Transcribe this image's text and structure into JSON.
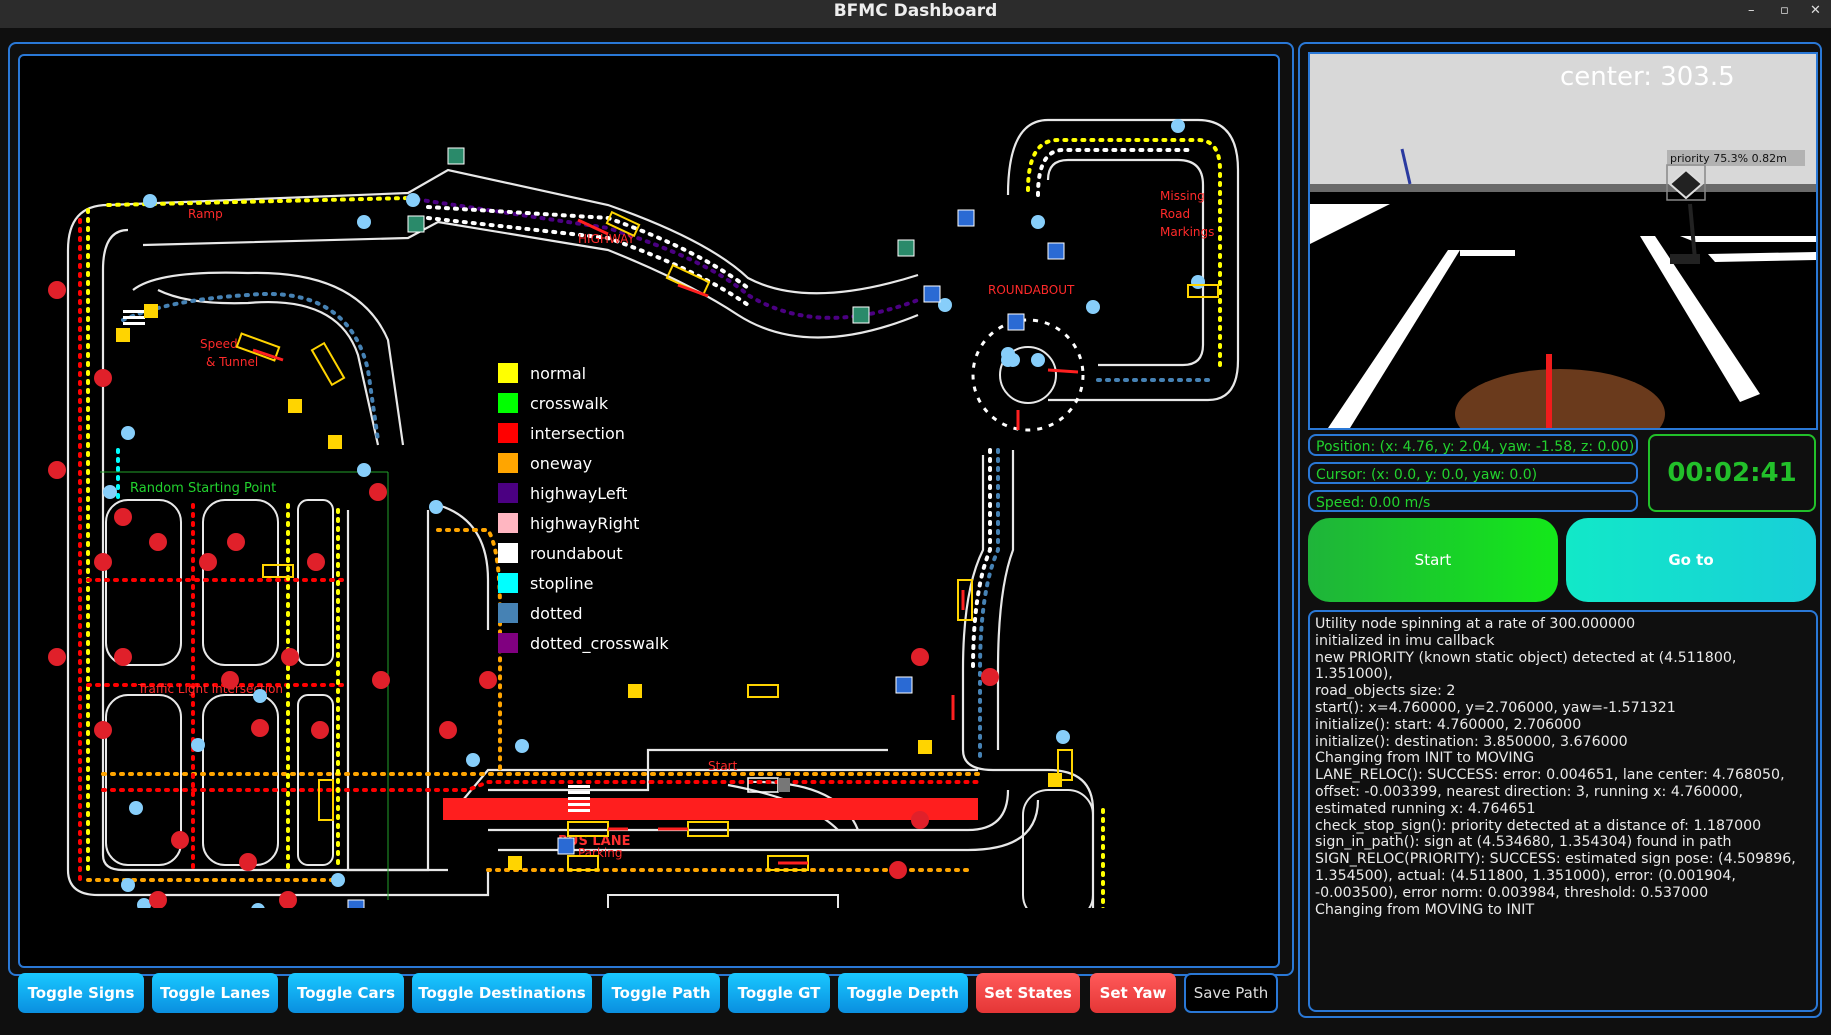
{
  "window": {
    "title": "BFMC Dashboard",
    "minimize": "–",
    "maximize": "▫",
    "close": "✕"
  },
  "camera": {
    "center_label": "center:",
    "center_value": "303.5",
    "detection_label": "priority  75.3%  0.82m"
  },
  "status": {
    "position": "Position: (x: 4.76, y: 2.04, yaw: -1.58, z: 0.00)",
    "cursor": "Cursor: (x: 0.0, y: 0.0, yaw: 0.0)",
    "speed": "Speed: 0.00 m/s",
    "timer": "00:02:41"
  },
  "actions": {
    "start": "Start",
    "goto": "Go to"
  },
  "log": [
    "Utility node spinning at a rate of 300.000000",
    "initialized in imu callback",
    "new PRIORITY (known static object) detected at (4.511800, 1.351000),",
    "road_objects size: 2",
    "start(): x=4.760000, y=2.706000, yaw=-1.571321",
    "initialize(): start: 4.760000, 2.706000",
    "initialize(): destination: 3.850000, 3.676000",
    "Changing from INIT to MOVING",
    "LANE_RELOC(): SUCCESS: error: 0.004651, lane center: 4.768050, offset: -0.003399, nearest direction: 3, running x: 4.760000, estimated running x: 4.764651",
    "check_stop_sign(): priority detected at a distance of: 1.187000",
    "sign_in_path(): sign at (4.534680, 1.354304) found in path",
    "SIGN_RELOC(PRIORITY): SUCCESS: estimated sign pose: (4.509896, 1.354500), actual: (4.511800, 1.351000), error: (0.001904, -0.003500), error norm: 0.003984, threshold: 0.537000",
    "Changing from MOVING to INIT"
  ],
  "toolbar": {
    "toggle_signs": "Toggle Signs",
    "toggle_lanes": "Toggle Lanes",
    "toggle_cars": "Toggle Cars",
    "toggle_destinations": "Toggle Destinations",
    "toggle_path": "Toggle Path",
    "toggle_gt": "Toggle GT",
    "toggle_depth": "Toggle Depth",
    "set_states": "Set States",
    "set_yaw": "Set Yaw",
    "save_path": "Save Path"
  },
  "map": {
    "labels": {
      "ramp": "Ramp",
      "highway": "HIGHWAY",
      "roundabout": "ROUNDABOUT",
      "missing_1": "Missing",
      "missing_2": "Road",
      "missing_3": "Markings",
      "speed_1": "Speed",
      "speed_2": "& Tunnel",
      "random_start": "Random Starting Point",
      "traffic_light": "Traffic Light Intersection",
      "bus_lane": "BUS LANE",
      "start": "Start",
      "parking": "Parking"
    },
    "legend": [
      {
        "color": "#ffff00",
        "label": "normal"
      },
      {
        "color": "#00ff00",
        "label": "crosswalk"
      },
      {
        "color": "#ff0000",
        "label": "intersection"
      },
      {
        "color": "#ffa500",
        "label": "oneway"
      },
      {
        "color": "#4b0082",
        "label": "highwayLeft"
      },
      {
        "color": "#ffb6c1",
        "label": "highwayRight"
      },
      {
        "color": "#ffffff",
        "label": "roundabout"
      },
      {
        "color": "#00ffff",
        "label": "stopline"
      },
      {
        "color": "#4682b4",
        "label": "dotted"
      },
      {
        "color": "#800080",
        "label": "dotted_crosswalk"
      }
    ]
  }
}
